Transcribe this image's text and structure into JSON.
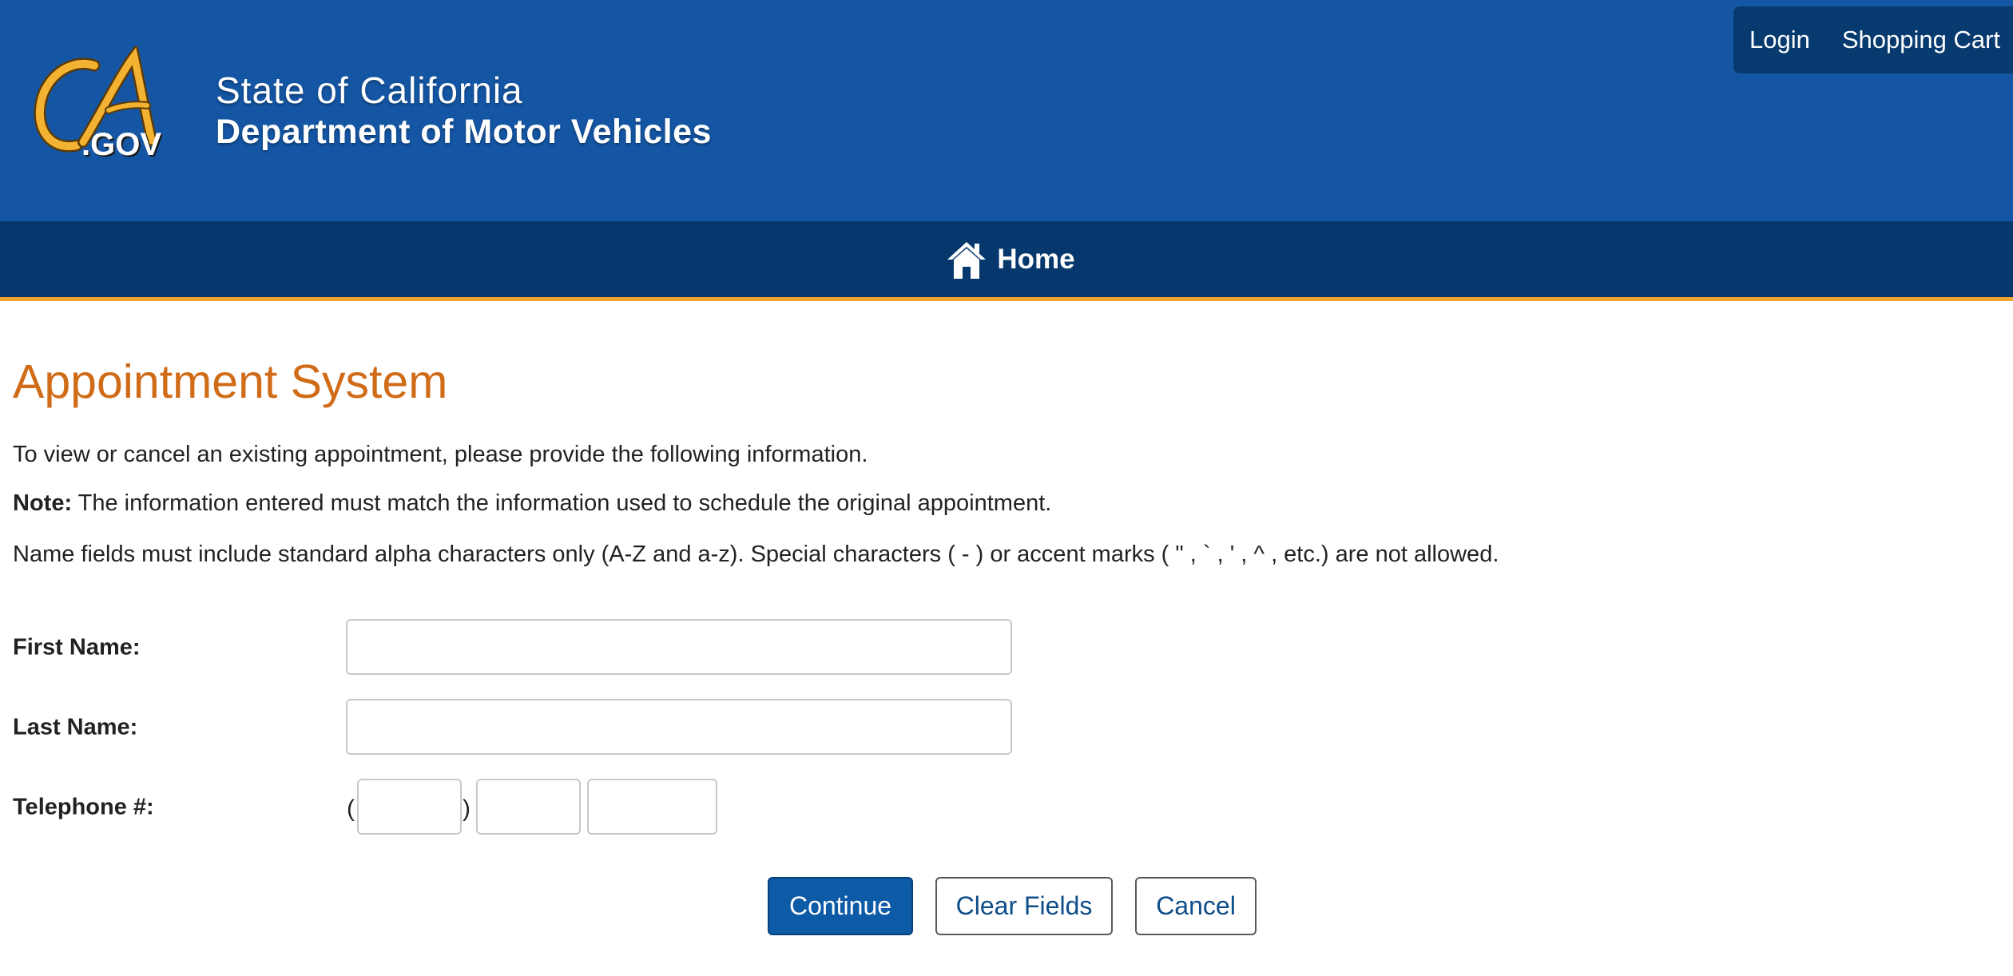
{
  "header": {
    "logo_text": "CA.GOV",
    "state_name": "State of California",
    "department": "Department of Motor Vehicles",
    "utility_links": {
      "login": "Login",
      "shopping_cart": "Shopping Cart"
    }
  },
  "nav": {
    "home_label": "Home"
  },
  "main": {
    "title": "Appointment System",
    "intro": "To view or cancel an existing appointment, please provide the following information.",
    "note_label": "Note:",
    "note_text": " The information entered must match the information used to schedule the original appointment.",
    "name_rules": "Name fields must include standard alpha characters only (A-Z and a-z). Special characters ( - ) or accent marks ( \" , ` , ' , ^ , etc.) are not allowed."
  },
  "form": {
    "first_name_label": "First Name:",
    "first_name_value": "",
    "last_name_label": "Last Name:",
    "last_name_value": "",
    "telephone_label": "Telephone #:",
    "phone_open_paren": "(",
    "phone_close_paren": ")",
    "phone_area_value": "",
    "phone_prefix_value": "",
    "phone_line_value": ""
  },
  "buttons": {
    "continue": "Continue",
    "clear": "Clear Fields",
    "cancel": "Cancel"
  },
  "colors": {
    "header_blue": "#1456a4",
    "nav_dark_blue": "#06386d",
    "accent_gold": "#f0a530",
    "title_orange": "#d06b17",
    "primary_button": "#0d5aa6"
  },
  "icons": {
    "logo": "ca-gov-logo",
    "home": "home-icon"
  }
}
